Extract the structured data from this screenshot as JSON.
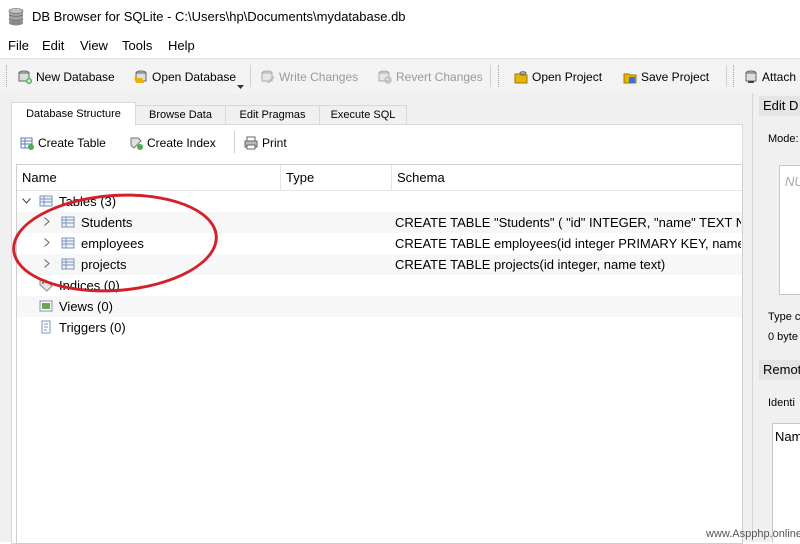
{
  "window": {
    "title": "DB Browser for SQLite - C:\\Users\\hp\\Documents\\mydatabase.db"
  },
  "menu": [
    "File",
    "Edit",
    "View",
    "Tools",
    "Help"
  ],
  "toolbar": {
    "new_database": "New Database",
    "open_database": "Open Database",
    "write_changes": "Write Changes",
    "revert_changes": "Revert Changes",
    "open_project": "Open Project",
    "save_project": "Save Project",
    "attach_database": "Attach D"
  },
  "tabs": [
    "Database Structure",
    "Browse Data",
    "Edit Pragmas",
    "Execute SQL"
  ],
  "structure_toolbar": {
    "create_table": "Create Table",
    "create_index": "Create Index",
    "print": "Print"
  },
  "tree": {
    "headers": {
      "name": "Name",
      "type": "Type",
      "schema": "Schema"
    },
    "tables_label": "Tables (3)",
    "tables": [
      {
        "name": "Students",
        "schema": "CREATE TABLE \"Students\" ( \"id\" INTEGER, \"name\" TEXT NOT"
      },
      {
        "name": "employees",
        "schema": "CREATE TABLE employees(id integer PRIMARY KEY, name te"
      },
      {
        "name": "projects",
        "schema": "CREATE TABLE projects(id integer, name text)"
      }
    ],
    "indices_label": "Indices (0)",
    "views_label": "Views (0)",
    "triggers_label": "Triggers (0)"
  },
  "right_pane": {
    "edit_header": "Edit D",
    "mode_label": "Mode:",
    "null_placeholder": "NU",
    "type_label": "Type c",
    "size_label": "0 byte",
    "remote_header": "Remot",
    "identity_label": "Identi",
    "name_col": "Nam"
  },
  "watermark": "www.Aspphp.online",
  "colors": {
    "annotation_circle": "#d4202a",
    "toolbar_bg": "#f3f3f3",
    "pane_bg": "#f0f0f0"
  }
}
